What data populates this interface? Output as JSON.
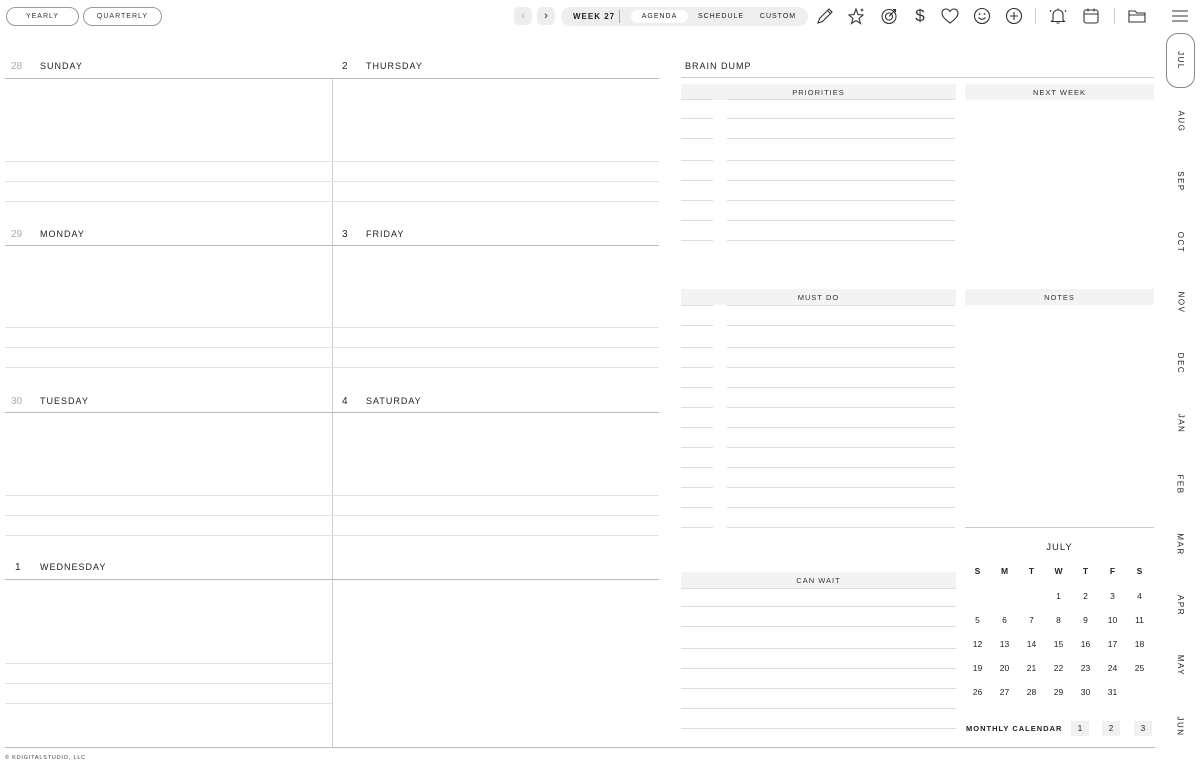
{
  "topbar": {
    "yearly": "YEARLY",
    "quarterly": "QUARTERLY",
    "prev": "‹",
    "next": "›",
    "week": "WEEK 27",
    "tabs": [
      "AGENDA",
      "SCHEDULE",
      "CUSTOM"
    ],
    "dollar": "$",
    "icons": [
      "pencil-icon",
      "sparkle-star-icon",
      "target-icon",
      "dollar-icon",
      "heart-icon",
      "smiley-icon",
      "plus-circle-icon",
      "bell-icon",
      "calendar-icon",
      "folder-icon",
      "menu-icon"
    ]
  },
  "days": [
    {
      "num": "28",
      "name": "SUNDAY"
    },
    {
      "num": "29",
      "name": "MONDAY"
    },
    {
      "num": "30",
      "name": "TUESDAY"
    },
    {
      "num": "1",
      "name": "WEDNESDAY"
    },
    {
      "num": "2",
      "name": "THURSDAY"
    },
    {
      "num": "3",
      "name": "FRIDAY"
    },
    {
      "num": "4",
      "name": "SATURDAY"
    }
  ],
  "brain_dump": {
    "title": "BRAIN DUMP",
    "priorities": "PRIORITIES",
    "next_week": "NEXT WEEK",
    "must_do": "MUST DO",
    "notes": "NOTES",
    "can_wait": "CAN WAIT"
  },
  "calendar": {
    "month": "JULY",
    "dow": [
      "S",
      "M",
      "T",
      "W",
      "T",
      "F",
      "S"
    ],
    "weeks": [
      [
        "",
        "",
        "",
        "1",
        "2",
        "3",
        "4"
      ],
      [
        "5",
        "6",
        "7",
        "8",
        "9",
        "10",
        "11"
      ],
      [
        "12",
        "13",
        "14",
        "15",
        "16",
        "17",
        "18"
      ],
      [
        "19",
        "20",
        "21",
        "22",
        "23",
        "24",
        "25"
      ],
      [
        "26",
        "27",
        "28",
        "29",
        "30",
        "31",
        ""
      ]
    ],
    "label": "MONTHLY CALENDAR",
    "pages": [
      "1",
      "2",
      "3"
    ]
  },
  "months": [
    "JUL",
    "AUG",
    "SEP",
    "OCT",
    "NOV",
    "DEC",
    "JAN",
    "FEB",
    "MAR",
    "APR",
    "MAY",
    "JUN"
  ],
  "footer": "© KDIGITALSTUDIO, LLC"
}
